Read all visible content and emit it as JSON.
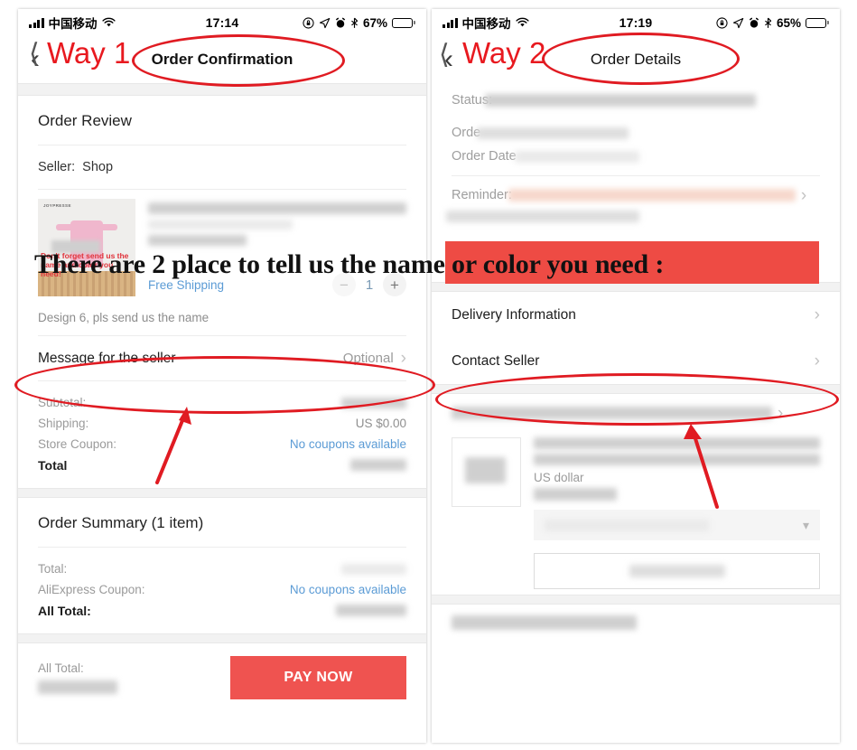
{
  "annotations": {
    "way1_label": "Way 1",
    "way2_label": "Way 2",
    "headline": "There are 2 place to tell us the name or color you need :",
    "accent_color": "#e01b22"
  },
  "left_phone": {
    "status_bar": {
      "carrier": "中国移动",
      "time": "17:14",
      "battery_percent": "67%",
      "icons": [
        "signal-bars-icon",
        "wifi-icon",
        "rotation-lock-icon",
        "location-arrow-icon",
        "alarm-clock-icon",
        "bluetooth-icon",
        "battery-icon"
      ]
    },
    "nav": {
      "title": "Order Confirmation",
      "back_icon": "chevron-left-icon"
    },
    "order_review": {
      "title": "Order Review",
      "seller_label": "Seller:",
      "seller_name": "Shop",
      "product": {
        "thumb_brand": "JOYPRESSE",
        "thumb_caption": "Don't forget send us the name and color you need!",
        "free_shipping": "Free Shipping",
        "quantity": "1",
        "minus_icon": "minus-icon",
        "plus_icon": "plus-icon"
      },
      "note": "Design 6, pls send us the name",
      "message_row": {
        "label": "Message for the seller",
        "value": "Optional",
        "chevron": "chevron-right-icon"
      },
      "prices": [
        {
          "label": "Subtotal:",
          "value": "",
          "blurred": true,
          "link": false,
          "bold": false
        },
        {
          "label": "Shipping:",
          "value": "US $0.00",
          "blurred": false,
          "link": false,
          "bold": false
        },
        {
          "label": "Store Coupon:",
          "value": "No coupons available",
          "blurred": false,
          "link": true,
          "bold": false
        },
        {
          "label": "Total",
          "value": "",
          "blurred": true,
          "link": false,
          "bold": true
        }
      ]
    },
    "order_summary": {
      "title": "Order Summary (1 item)",
      "prices": [
        {
          "label": "Total:",
          "value": "",
          "blurred": true,
          "link": false,
          "bold": false
        },
        {
          "label": "AliExpress Coupon:",
          "value": "No coupons available",
          "blurred": false,
          "link": true,
          "bold": false
        },
        {
          "label": "All Total:",
          "value": "",
          "blurred": true,
          "link": false,
          "bold": true
        }
      ]
    },
    "footer": {
      "total_label": "All Total:",
      "pay_button": "PAY NOW"
    }
  },
  "right_phone": {
    "status_bar": {
      "carrier": "中国移动",
      "time": "17:19",
      "battery_percent": "65%",
      "icons": [
        "signal-bars-icon",
        "wifi-icon",
        "rotation-lock-icon",
        "location-arrow-icon",
        "alarm-clock-icon",
        "bluetooth-icon",
        "battery-icon"
      ]
    },
    "nav": {
      "title": "Order Details",
      "back_icon": "chevron-left-icon"
    },
    "details": {
      "status_label": "Status:",
      "order_label": "Orde",
      "order_date_label": "Order Date",
      "reminder_label": "Reminder:"
    },
    "links": [
      {
        "label": "Delivery Information",
        "chevron": "chevron-right-icon"
      },
      {
        "label": "Contact Seller",
        "chevron": "chevron-right-icon"
      }
    ],
    "product": {
      "currency_note": "US dollar",
      "dropdown_icon": "chevron-down-icon"
    }
  }
}
